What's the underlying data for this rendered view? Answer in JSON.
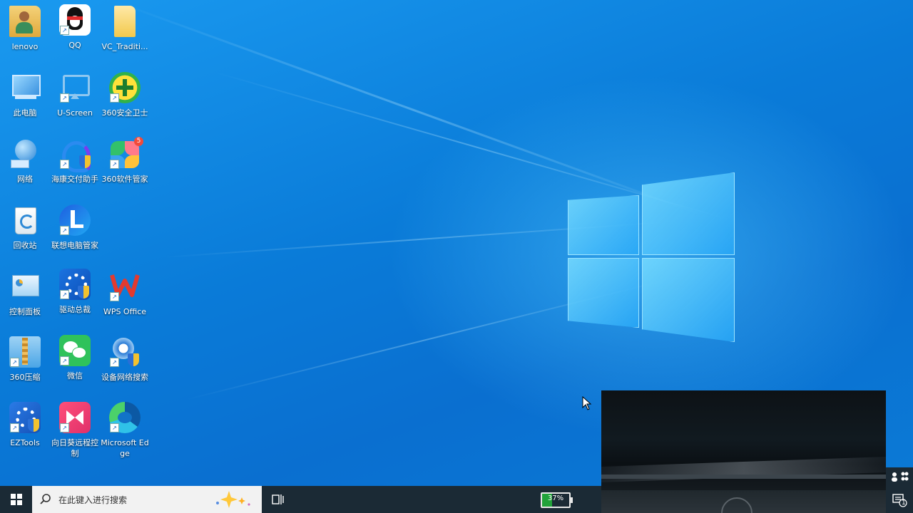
{
  "desktop": {
    "icons": [
      {
        "label": "lenovo",
        "icon": "user-folder-icon"
      },
      {
        "label": "QQ",
        "icon": "qq-penguin-icon"
      },
      {
        "label": "VC_Traditi...",
        "icon": "folder-icon"
      },
      {
        "label": "此电脑",
        "icon": "computer-icon"
      },
      {
        "label": "U-Screen",
        "icon": "screen-cast-icon"
      },
      {
        "label": "360安全卫士",
        "icon": "360-security-icon"
      },
      {
        "label": "网络",
        "icon": "network-globe-icon"
      },
      {
        "label": "海康交付助手",
        "icon": "hikvision-assistant-icon"
      },
      {
        "label": "360软件管家",
        "icon": "360-software-manager-icon"
      },
      {
        "label": "回收站",
        "icon": "recycle-bin-icon"
      },
      {
        "label": "联想电脑管家",
        "icon": "lenovo-manager-icon"
      },
      {
        "label": "控制面板",
        "icon": "control-panel-icon"
      },
      {
        "label": "驱动总裁",
        "icon": "driver-tool-icon"
      },
      {
        "label": "WPS Office",
        "icon": "wps-office-icon"
      },
      {
        "label": "360压缩",
        "icon": "360-zip-icon"
      },
      {
        "label": "微信",
        "icon": "wechat-icon"
      },
      {
        "label": "设备网络搜索",
        "icon": "device-network-search-icon"
      },
      {
        "label": "EZTools",
        "icon": "eztools-icon"
      },
      {
        "label": "向日葵远程控制",
        "icon": "sunflower-remote-icon"
      },
      {
        "label": "Microsoft Edge",
        "icon": "edge-icon"
      }
    ],
    "badge_360_software": "5"
  },
  "taskbar": {
    "search_placeholder": "在此键入进行搜索",
    "battery_percent": 37,
    "battery_label": "37%",
    "notification_count": "1"
  },
  "colors": {
    "taskbar_bg": "#1b2a35",
    "battery_green": "#21a33a",
    "wallpaper_blue": "#0a7bd8"
  }
}
